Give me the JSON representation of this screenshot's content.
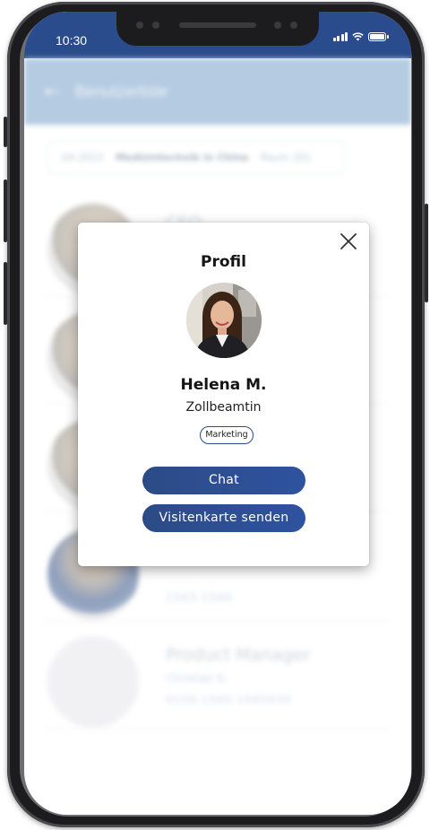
{
  "status_bar": {
    "time": "10:30",
    "icons": [
      "cellular-signal-icon",
      "wifi-icon",
      "battery-icon"
    ]
  },
  "app": {
    "header": {
      "back_icon": "arrow-left-icon",
      "title": "Benutzerliste"
    },
    "breadcrumb": {
      "date": ".04.2023",
      "event": "Medizintechnik in China",
      "room": "Raum 201"
    },
    "users": [
      {
        "role": "CEO",
        "name": "",
        "phone": ""
      },
      {
        "role": "",
        "name": "",
        "phone": ""
      },
      {
        "role": "",
        "name": "",
        "phone": ""
      },
      {
        "role": "",
        "name": "",
        "phone": "1563-1560"
      },
      {
        "role": "Product Manager",
        "name": "Christian K.",
        "phone": "0156-1560-1565630"
      }
    ]
  },
  "modal": {
    "title": "Profil",
    "close_icon": "close-icon",
    "name": "Helena M.",
    "job_title": "Zollbeamtin",
    "tag": "Marketing",
    "chat_label": "Chat",
    "send_card_label": "Visitenkarte senden"
  },
  "colors": {
    "primary": "#2b4c8c",
    "header_bg": "#a7c2dc",
    "button_gradient_end": "#2f52a0"
  }
}
